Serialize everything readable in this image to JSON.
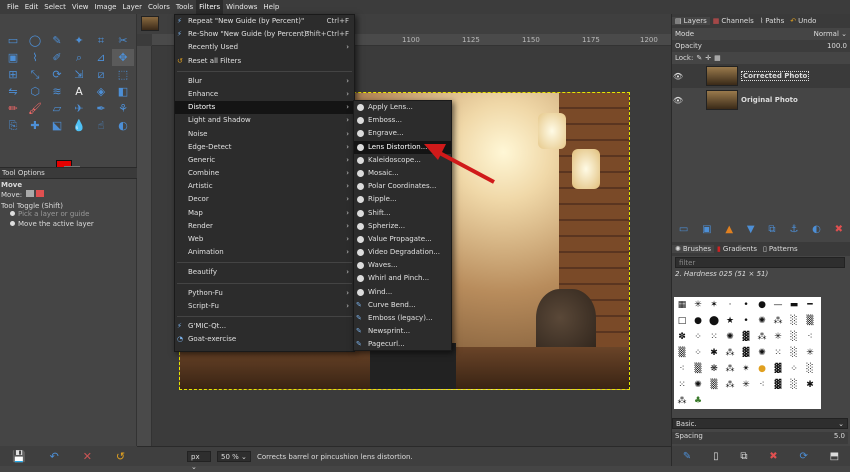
{
  "menubar": {
    "items": [
      "File",
      "Edit",
      "Select",
      "View",
      "Image",
      "Layer",
      "Colors",
      "Tools",
      "Filters",
      "Windows",
      "Help"
    ]
  },
  "toolbox": {
    "tool_options_tab": "Tool Options",
    "tool_name": "Move",
    "move_label": "Move:",
    "tool_toggle": "Tool Toggle  (Shift)",
    "option_pick": "Pick a layer or guide",
    "option_move_active": "Move the active layer",
    "fg_color": "#e50000",
    "bg_color": "#000000"
  },
  "rulers": {
    "labels": [
      "1100",
      "1125",
      "1150",
      "1175",
      "1200"
    ]
  },
  "filters_menu": {
    "repeat": {
      "label": "Repeat \"New Guide (by Percent)\"",
      "shortcut": "Ctrl+F"
    },
    "reshow": {
      "label": "Re-Show \"New Guide (by Percent)\"",
      "shortcut": "Shift+Ctrl+F"
    },
    "recently_used": "Recently Used",
    "reset_all": "Reset all Filters",
    "groups": [
      "Blur",
      "Enhance",
      "Distorts",
      "Light and Shadow",
      "Noise",
      "Edge-Detect",
      "Generic",
      "Combine",
      "Artistic",
      "Decor",
      "Map",
      "Render",
      "Web",
      "Animation"
    ],
    "beautify": "Beautify",
    "python_fu": "Python-Fu",
    "script_fu": "Script-Fu",
    "gmic": "G'MIC-Qt...",
    "goat": "Goat-exercise"
  },
  "distorts_menu": {
    "items": [
      "Apply Lens...",
      "Emboss...",
      "Engrave...",
      "Lens Distortion...",
      "Kaleidoscope...",
      "Mosaic...",
      "Polar Coordinates...",
      "Ripple...",
      "Shift...",
      "Spherize...",
      "Value Propagate...",
      "Video Degradation...",
      "Waves...",
      "Whirl and Pinch...",
      "Wind...",
      "Curve Bend...",
      "Emboss (legacy)...",
      "Newsprint...",
      "Pagecurl..."
    ]
  },
  "layers_panel": {
    "tabs": [
      "Layers",
      "Channels",
      "Paths",
      "Undo"
    ],
    "mode_label": "Mode",
    "mode_value": "Normal",
    "opacity_label": "Opacity",
    "opacity_value": "100.0",
    "lock_label": "Lock:",
    "layers": [
      {
        "name": "Corrected Photo"
      },
      {
        "name": "Original Photo"
      }
    ]
  },
  "brushes_panel": {
    "tabs": [
      "Brushes",
      "Gradients",
      "Patterns"
    ],
    "filter_placeholder": "filter",
    "current_brush": "2. Hardness 025 (51 × 51)",
    "preset": "Basic.",
    "spacing_label": "Spacing",
    "spacing_value": "5.0"
  },
  "statusbar": {
    "unit": "px",
    "zoom": "50 %",
    "message": "Corrects barrel or pincushion lens distortion."
  },
  "colors": {
    "highlight": "#141414",
    "accent_arrow": "#d01a1a",
    "selection_border": "#e6e600"
  }
}
